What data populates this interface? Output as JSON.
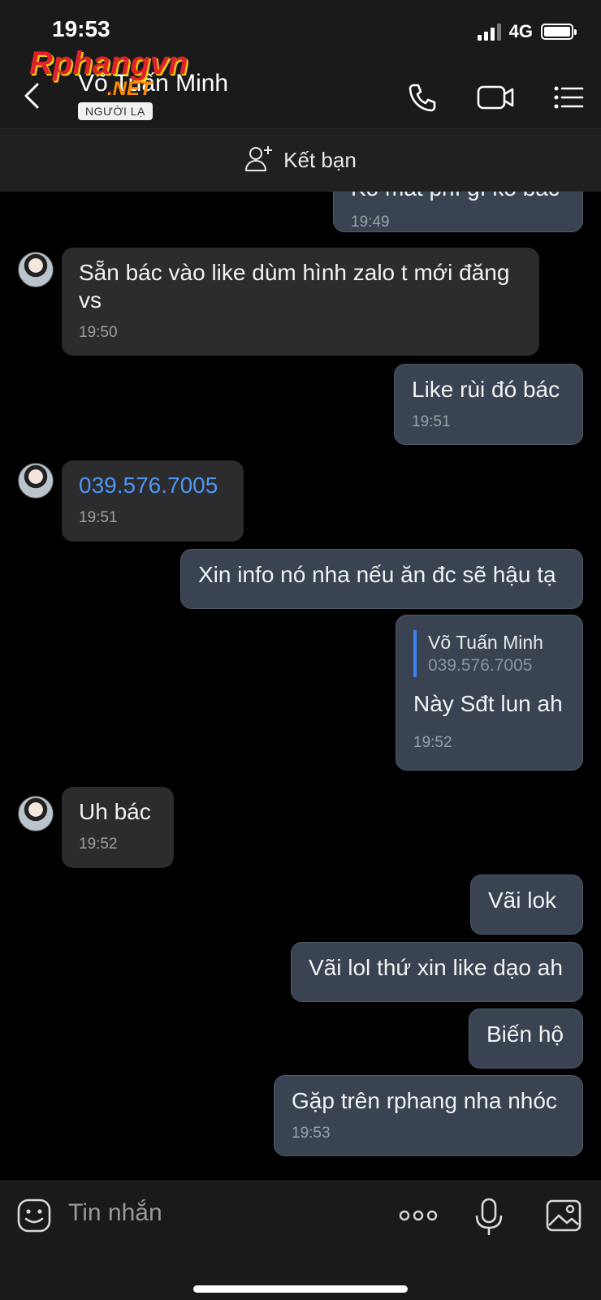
{
  "status_bar": {
    "time": "19:53",
    "network": "4G"
  },
  "header": {
    "contact_name": "Võ Tuấn Minh",
    "badge": "NGƯỜI LẠ",
    "watermark_main": "Rphangvn",
    "watermark_suffix": ".NET",
    "icons": [
      "back-icon",
      "phone-icon",
      "video-icon",
      "menu-icon"
    ]
  },
  "friend_bar": {
    "label": "Kết bạn"
  },
  "messages": [
    {
      "direction": "out",
      "text": "Ko mất phí gì ko bác",
      "time": "19:49"
    },
    {
      "direction": "in",
      "text": "Sẵn bác vào like dùm hình zalo t mới đăng vs",
      "time": "19:50"
    },
    {
      "direction": "out",
      "text": "Like rùi đó bác",
      "time": "19:51"
    },
    {
      "direction": "in",
      "text": "039.576.7005",
      "time": "19:51",
      "is_link": true
    },
    {
      "direction": "out",
      "text": "Xin info nó nha nếu ăn đc sẽ hậu tạ"
    },
    {
      "direction": "out",
      "quote_name": "Võ Tuấn Minh",
      "quote_text": "039.576.7005",
      "text": "Này Sđt lun ah",
      "time": "19:52"
    },
    {
      "direction": "in",
      "text": "Uh bác",
      "time": "19:52"
    },
    {
      "direction": "out",
      "text": "Vãi lok"
    },
    {
      "direction": "out",
      "text": "Vãi lol thứ xin like dạo ah"
    },
    {
      "direction": "out",
      "text": "Biến hộ"
    },
    {
      "direction": "out",
      "text": "Gặp trên rphang nha nhóc",
      "time": "19:53"
    }
  ],
  "input_bar": {
    "placeholder": "Tin nhắn"
  },
  "colors": {
    "background": "#000000",
    "bar": "#1a1a1a",
    "incoming_bubble": "#2c2c2e",
    "outgoing_bubble": "#3a4352",
    "link": "#4e95f4",
    "quote_accent": "#3b82f6"
  }
}
